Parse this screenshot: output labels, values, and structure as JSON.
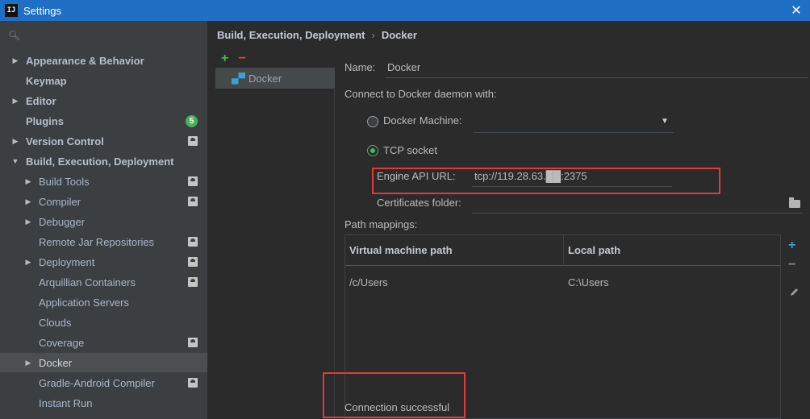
{
  "window": {
    "title": "Settings",
    "app_icon": "IJ"
  },
  "sidebar": {
    "search_placeholder": "Q̥",
    "items": [
      {
        "label": "Appearance & Behavior",
        "bold": true,
        "expandable": true
      },
      {
        "label": "Keymap",
        "bold": true
      },
      {
        "label": "Editor",
        "bold": true,
        "expandable": true
      },
      {
        "label": "Plugins",
        "bold": true,
        "badge": "5"
      },
      {
        "label": "Version Control",
        "bold": true,
        "expandable": true
      },
      {
        "label": "Build, Execution, Deployment",
        "bold": true,
        "expanded": true
      },
      {
        "label": "Build Tools",
        "expandable": true
      },
      {
        "label": "Compiler",
        "expandable": true
      },
      {
        "label": "Debugger",
        "expandable": true
      },
      {
        "label": "Remote Jar Repositories"
      },
      {
        "label": "Deployment",
        "expandable": true
      },
      {
        "label": "Arquillian Containers"
      },
      {
        "label": "Application Servers"
      },
      {
        "label": "Clouds"
      },
      {
        "label": "Coverage"
      },
      {
        "label": "Docker",
        "expandable": true,
        "selected": true
      },
      {
        "label": "Gradle-Android Compiler"
      },
      {
        "label": "Instant Run"
      }
    ]
  },
  "breadcrumb": {
    "parent": "Build, Execution, Deployment",
    "separator": "›",
    "current": "Docker"
  },
  "list": {
    "add": "+",
    "remove": "−",
    "entry": "Docker"
  },
  "form": {
    "name_label": "Name:",
    "name_value": "Docker",
    "connect_label": "Connect to Docker daemon with:",
    "docker_machine_label": "Docker Machine:",
    "tcp_label": "TCP socket",
    "engine_label": "Engine API URL:",
    "engine_value": "tcp://119.28.63.██:2375",
    "certs_label": "Certificates folder:",
    "path_mappings_label": "Path mappings:",
    "table": {
      "columns": [
        "Virtual machine path",
        "Local path"
      ],
      "rows": [
        [
          "/c/Users",
          "C:\\Users"
        ]
      ]
    },
    "status": "Connection successful"
  },
  "colors": {
    "accent": "#1f6fc5",
    "add": "#4db35c",
    "remove": "#d34a4a",
    "highlight": "#e03a3a"
  }
}
